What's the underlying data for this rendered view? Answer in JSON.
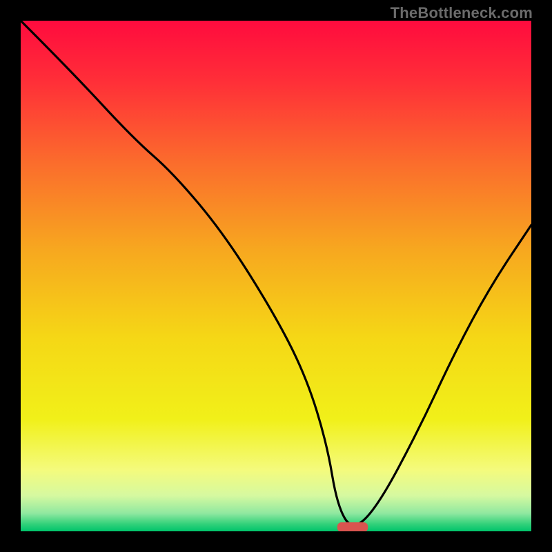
{
  "watermark": "TheBottleneck.com",
  "chart_data": {
    "type": "line",
    "title": "",
    "xlabel": "",
    "ylabel": "",
    "xlim": [
      0,
      100
    ],
    "ylim": [
      0,
      100
    ],
    "grid": false,
    "legend": false,
    "annotations": [],
    "series": [
      {
        "name": "bottleneck-curve",
        "x": [
          0,
          10,
          22,
          30,
          40,
          50,
          56,
          60,
          62,
          65,
          70,
          78,
          85,
          92,
          100
        ],
        "values": [
          100,
          90,
          77,
          70,
          58,
          42,
          30,
          17,
          5,
          0,
          5,
          20,
          35,
          48,
          60
        ]
      }
    ],
    "marker": {
      "name": "optimal-marker",
      "x_start": 62,
      "x_end": 68,
      "y": 0,
      "color": "#d9544f"
    },
    "background_gradient": {
      "stops": [
        {
          "offset": 0.0,
          "color": "#ff0b3e"
        },
        {
          "offset": 0.12,
          "color": "#ff2f38"
        },
        {
          "offset": 0.28,
          "color": "#fb6d2c"
        },
        {
          "offset": 0.45,
          "color": "#f7a81f"
        },
        {
          "offset": 0.62,
          "color": "#f5d716"
        },
        {
          "offset": 0.78,
          "color": "#f1f019"
        },
        {
          "offset": 0.88,
          "color": "#f4fb7d"
        },
        {
          "offset": 0.93,
          "color": "#d6f9a0"
        },
        {
          "offset": 0.965,
          "color": "#8fe8a0"
        },
        {
          "offset": 0.985,
          "color": "#35d27b"
        },
        {
          "offset": 1.0,
          "color": "#00c46b"
        }
      ]
    }
  }
}
